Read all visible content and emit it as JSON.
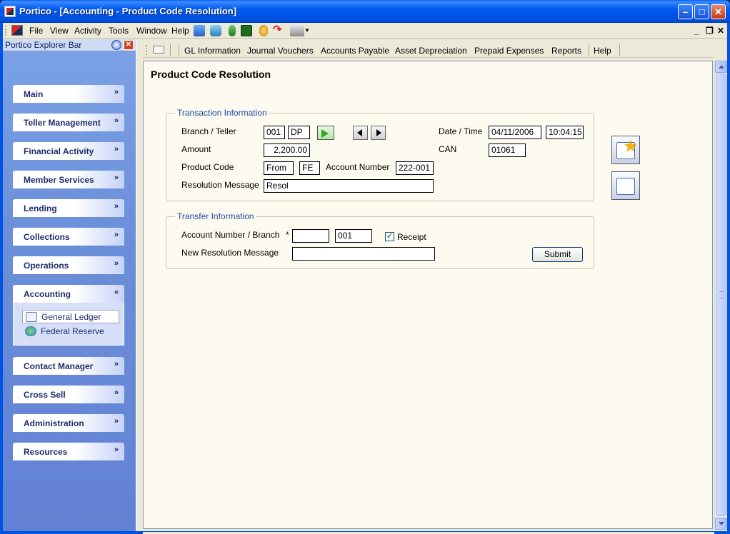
{
  "window": {
    "title": "Portico - [Accounting - Product Code Resolution]"
  },
  "menubar": {
    "items": [
      "File",
      "View",
      "Activity",
      "Tools",
      "Window",
      "Help"
    ]
  },
  "explorer": {
    "title": "Portico Explorer Bar",
    "groups": [
      {
        "label": "Main",
        "expanded": false
      },
      {
        "label": "Teller Management",
        "expanded": false
      },
      {
        "label": "Financial Activity",
        "expanded": false
      },
      {
        "label": "Member Services",
        "expanded": false
      },
      {
        "label": "Lending",
        "expanded": false
      },
      {
        "label": "Collections",
        "expanded": false
      },
      {
        "label": "Operations",
        "expanded": false
      },
      {
        "label": "Accounting",
        "expanded": true
      },
      {
        "label": "Contact Manager",
        "expanded": false
      },
      {
        "label": "Cross Sell",
        "expanded": false
      },
      {
        "label": "Administration",
        "expanded": false
      },
      {
        "label": "Resources",
        "expanded": false
      }
    ],
    "accounting_items": [
      {
        "label": "General Ledger",
        "icon": "book-icon",
        "selected": true
      },
      {
        "label": "Federal Reserve",
        "icon": "globe-icon",
        "selected": false
      }
    ]
  },
  "navbar": {
    "items": [
      "GL Information",
      "Journal Vouchers",
      "Accounts Payable",
      "Asset Depreciation",
      "Prepaid Expenses",
      "Reports",
      "Help"
    ]
  },
  "page": {
    "title": "Product Code Resolution",
    "transaction": {
      "legend": "Transaction Information",
      "branch_teller_label": "Branch / Teller",
      "branch": "001",
      "teller": "DP",
      "date_time_label": "Date / Time",
      "date": "04/11/2006",
      "time": "10:04:15",
      "amount_label": "Amount",
      "amount": "2,200.00",
      "can_label": "CAN",
      "can": "01061",
      "product_code_label": "Product Code",
      "product_code_from": "From",
      "product_code_to": "FE",
      "account_number_label": "Account Number",
      "account_number": "222-001",
      "resolution_message_label": "Resolution Message",
      "resolution_message": "Resol"
    },
    "transfer": {
      "legend": "Transfer Information",
      "account_branch_label": "Account Number / Branch",
      "required_mark": "*",
      "account_number": "",
      "branch": "001",
      "receipt_label": "Receipt",
      "receipt_checked": true,
      "new_message_label": "New Resolution Message",
      "new_message": "",
      "submit_label": "Submit"
    }
  }
}
